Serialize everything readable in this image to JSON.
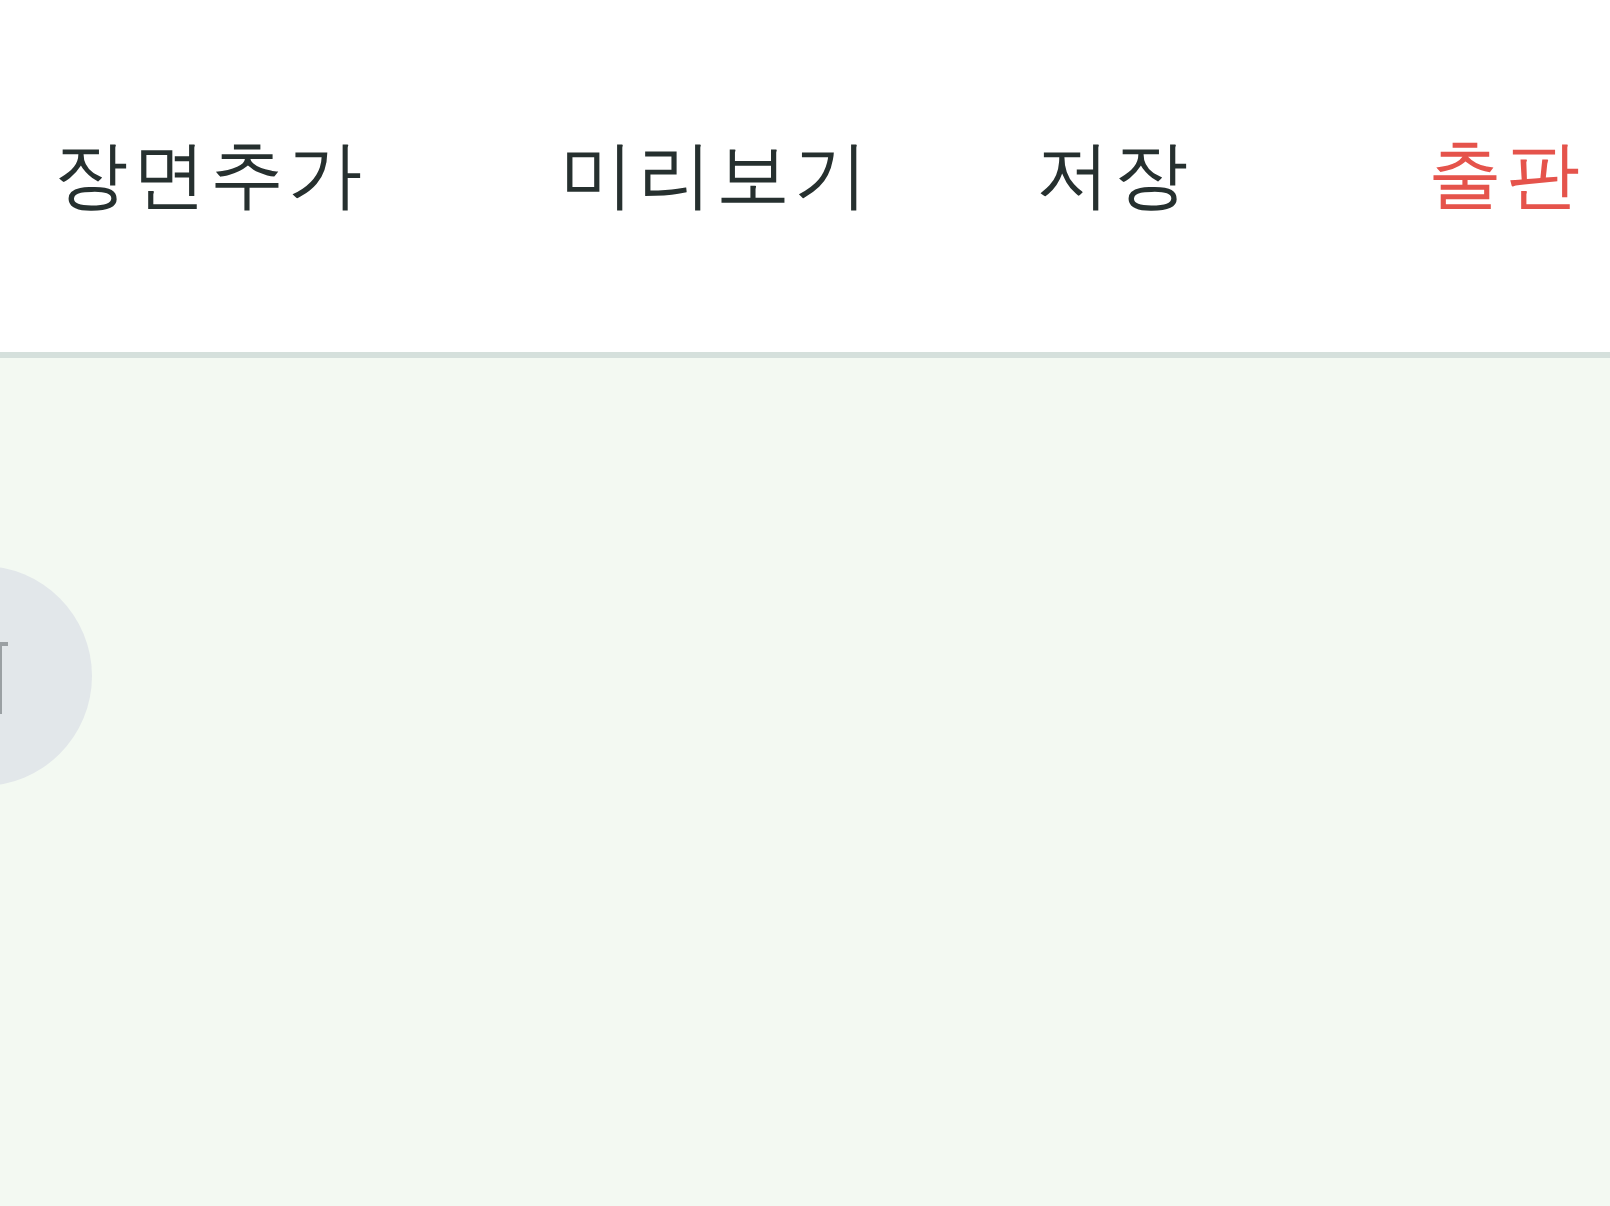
{
  "toolbar": {
    "buttons": [
      {
        "label": "장면추가",
        "kind": "normal"
      },
      {
        "label": "미리보기",
        "kind": "normal"
      },
      {
        "label": "저장",
        "kind": "normal"
      },
      {
        "label": "출판",
        "kind": "primary"
      }
    ]
  },
  "floating_button": {
    "kind": "delete"
  }
}
